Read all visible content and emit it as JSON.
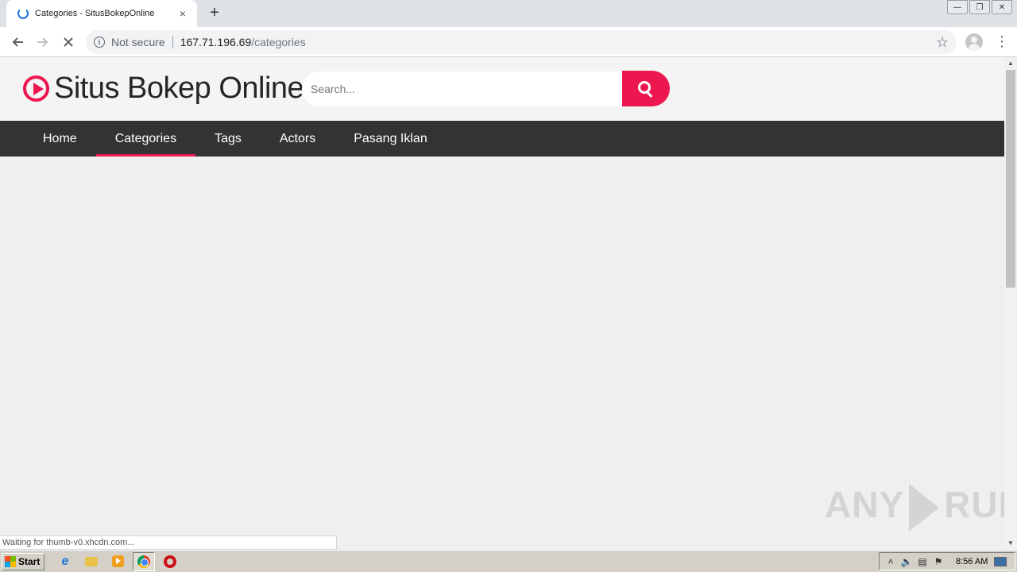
{
  "browser": {
    "tab_title": "Categories - SitusBokepOnline",
    "tab_close": "×",
    "new_tab": "+",
    "security_label": "Not secure",
    "url_host": "167.71.196.69",
    "url_path": "/categories",
    "window_controls": [
      "minimize",
      "restore",
      "close"
    ]
  },
  "site": {
    "logo_text": "Situs Bokep Online",
    "search_placeholder": "Search...",
    "brand_color": "#ec174f",
    "nav": [
      {
        "label": "Home",
        "active": false
      },
      {
        "label": "Categories",
        "active": true
      },
      {
        "label": "Tags",
        "active": false
      },
      {
        "label": "Actors",
        "active": false
      },
      {
        "label": "Pasang Iklan",
        "active": false
      }
    ]
  },
  "status_text": "Waiting for thumb-v0.xhcdn.com...",
  "watermark": {
    "left": "ANY",
    "right": "RUN"
  },
  "taskbar": {
    "start_label": "Start",
    "clock": "8:56 AM",
    "icons": [
      "ie-icon",
      "folder-icon",
      "media-player-icon",
      "chrome-icon",
      "opera-icon"
    ]
  }
}
